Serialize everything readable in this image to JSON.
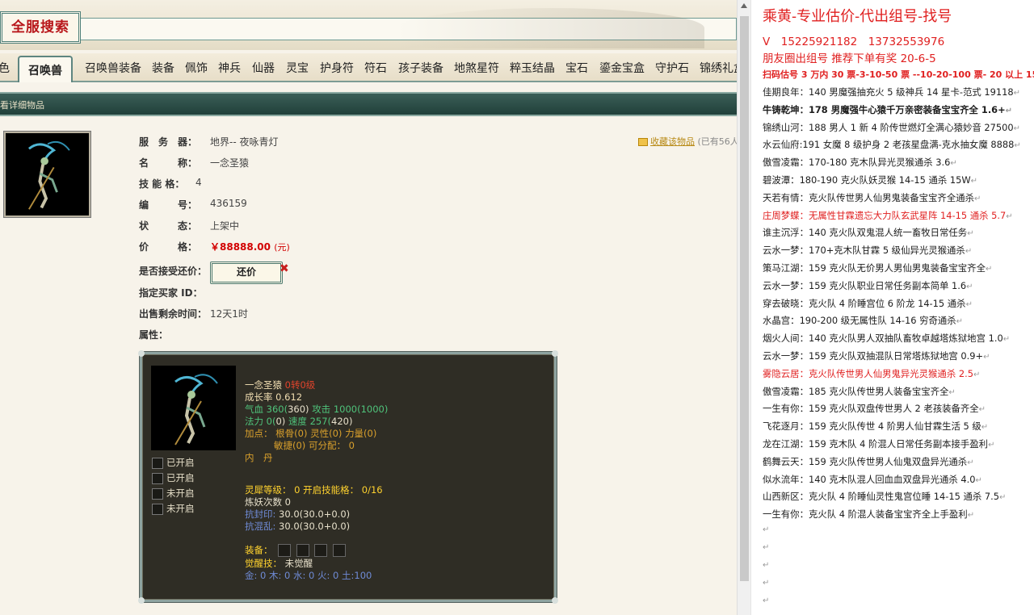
{
  "search": {
    "logo_text": "全服搜索",
    "input_value": ""
  },
  "tabs": [
    {
      "label": "色",
      "active": false
    },
    {
      "label": "召唤兽",
      "active": true
    },
    {
      "label": "召唤兽装备",
      "active": false
    },
    {
      "label": "装备",
      "active": false
    },
    {
      "label": "佩饰",
      "active": false
    },
    {
      "label": "神兵",
      "active": false
    },
    {
      "label": "仙器",
      "active": false
    },
    {
      "label": "灵宝",
      "active": false
    },
    {
      "label": "护身符",
      "active": false
    },
    {
      "label": "符石",
      "active": false
    },
    {
      "label": "孩子装备",
      "active": false
    },
    {
      "label": "地煞星符",
      "active": false
    },
    {
      "label": "粹玉结晶",
      "active": false
    },
    {
      "label": "宝石",
      "active": false
    },
    {
      "label": "鎏金宝盒",
      "active": false
    },
    {
      "label": "守护石",
      "active": false
    },
    {
      "label": "锦绣礼盒",
      "active": false
    }
  ],
  "section_title": "看详细物品",
  "favorite": {
    "label": "收藏该物品",
    "count_text": "(已有56人"
  },
  "detail": {
    "server_label": "服　务　器：",
    "server_value": "地界-- 夜咏青灯",
    "name_label": "名　　　称：",
    "name_value": "一念圣猿",
    "skill_label": "技 能 格：",
    "skill_value": "4",
    "id_label": "编　　　号：",
    "id_value": "436159",
    "status_label": "状　　　态：",
    "status_value": "上架中",
    "price_label": "价　　　格：",
    "price_value": "￥88888.00",
    "price_unit": "(元)",
    "bargain_label": "是否接受还价：",
    "bargain_button": "还价",
    "bargain_close": "✖",
    "buyer_label": "指定买家 ID：",
    "buyer_value": "",
    "time_label": "出售剩余时间：",
    "time_value": "12天1时",
    "attr_label": "属性："
  },
  "panel": {
    "name": "一念圣猿",
    "rebirth": "0转0级",
    "growth": "成长率 0.612",
    "hp_label": "气血",
    "hp": "360(",
    "hp_max": "360)",
    "atk_label": "攻击",
    "atk": "1000(1000)",
    "mp_label": "法力",
    "mp": "0(",
    "mp_max": "0)",
    "spd_label": "速度",
    "spd": "257(",
    "spd_max": "420)",
    "points_label": "加点：",
    "root": "根骨(0)",
    "spirit": "灵性(0)",
    "power": "力量(0)",
    "agility": "敏捷(0)",
    "free": "可分配：",
    "free_val": "0",
    "inner": "内　丹",
    "slots": [
      {
        "label": "已开启"
      },
      {
        "label": "已开启"
      },
      {
        "label": "未开启"
      },
      {
        "label": "未开启"
      }
    ],
    "spirit_level": "灵犀等级： 0 开启技能格： 0/16",
    "refine": "炼妖次数 0",
    "resist_seal_label": "抗封印:",
    "resist_seal": "30.0(30.0+0.0)",
    "resist_chaos_label": "抗混乱:",
    "resist_chaos": "30.0(30.0+0.0)",
    "equip_label": "装备：",
    "awaken_label": "觉醒技：",
    "awaken_value": "未觉醒",
    "elements": "金: 0 木: 0 水: 0 火: 0 土:100"
  },
  "notes": {
    "title": "乘黄-专业估价-代出组号-找号",
    "phone": "V　15225921182　13732553976",
    "friend": "朋友圈出组号 推荐下单有奖 20-6-5",
    "price_line": "扫码估号 3 万内 30 票-3-10-50 票 --10-20-100 票- 20 以上 150",
    "entries": [
      {
        "text": "佳期良年：140 男魔强抽充火 5 级神兵 14 星卡-范式 19118",
        "style": ""
      },
      {
        "text": "牛铸乾坤：178 男魔强牛心猿千万亲密装备宝宝齐全 1.6+",
        "style": "bold"
      },
      {
        "text": "锦绣山河：188 男人 1 新 4 阶传世燃灯全满心猿妙音 27500",
        "style": ""
      },
      {
        "text": "水云仙府:191 女魔 8 级护身 2 老孩星盘满-克水抽女魔 8888",
        "style": ""
      },
      {
        "text": "傲雪凌霜：170-180 克木队异光灵猴通杀 3.6",
        "style": ""
      },
      {
        "text": "碧波潭：180-190 克火队妖灵猴 14-15 通杀 15W",
        "style": ""
      },
      {
        "text": "天若有情：克火队传世男人仙男鬼装备宝宝齐全通杀",
        "style": ""
      },
      {
        "text": "庄周梦蝶：无属性甘霖遗忘大力队玄武星阵 14-15 通杀 5.7",
        "style": "red"
      },
      {
        "text": "谁主沉浮：140 克火队双鬼混人统一畜牧日常任务",
        "style": ""
      },
      {
        "text": "云水一梦：170+克木队甘霖 5 级仙异光灵猴通杀",
        "style": ""
      },
      {
        "text": "策马江湖：159 克火队无价男人男仙男鬼装备宝宝齐全",
        "style": ""
      },
      {
        "text": "云水一梦：159 克火队职业日常任务副本简单 1.6",
        "style": ""
      },
      {
        "text": "穿去破晓：克火队 4 阶睡宫位 6 阶龙 14-15 通杀",
        "style": ""
      },
      {
        "text": "水晶宫：190-200 级无属性队 14-16 穷奇通杀",
        "style": ""
      },
      {
        "text": "烟火人间：140 克火队男人双抽队畜牧卓越塔炼狱地宫 1.0",
        "style": ""
      },
      {
        "text": "云水一梦：159 克火队双抽混队日常塔炼狱地宫 0.9+",
        "style": ""
      },
      {
        "text": "雾隐云居：克火队传世男人仙男鬼异光灵猴通杀 2.5",
        "style": "red"
      },
      {
        "text": "傲雪凌霜：185 克火队传世男人装备宝宝齐全",
        "style": ""
      },
      {
        "text": "一生有你：159 克火队双盘传世男人 2 老孩装备齐全",
        "style": ""
      },
      {
        "text": "飞花逐月：159 克火队传世 4 阶男人仙甘霖生活 5 级",
        "style": ""
      },
      {
        "text": "龙在江湖：159 克木队 4 阶混人日常任务副本接手盈利",
        "style": ""
      },
      {
        "text": "鹤舞云天：159 克火队传世男人仙鬼双盘异光通杀",
        "style": ""
      },
      {
        "text": "似水流年：140 克木队混人回血血双盘异光通杀 4.0",
        "style": ""
      },
      {
        "text": "山西新区：克火队 4 阶睡仙灵性鬼宫位睡 14-15 通杀 7.5",
        "style": ""
      },
      {
        "text": "一生有你：克火队 4 阶混人装备宝宝齐全上手盈利",
        "style": ""
      }
    ],
    "paragraph_mark": "↵"
  }
}
